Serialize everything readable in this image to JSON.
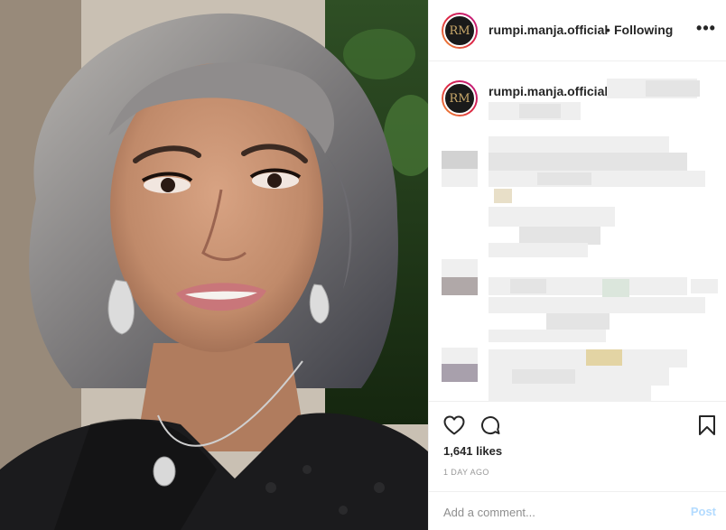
{
  "post": {
    "username": "rumpi.manja.official",
    "separator": "•",
    "follow_status": "Following",
    "more_label": "•••",
    "avatar_monogram": "RM",
    "likes": "1,641 likes",
    "time": "1 DAY AGO",
    "comment_placeholder": "Add a comment...",
    "post_label": "Post"
  },
  "icons": {
    "like": "heart-icon",
    "comment": "comment-bubble-icon",
    "save": "bookmark-icon",
    "more": "more-options-icon"
  },
  "colors": {
    "text": "#262626",
    "muted": "#8e8e8e",
    "post_button": "#b3dbff",
    "divider": "#efefef"
  }
}
